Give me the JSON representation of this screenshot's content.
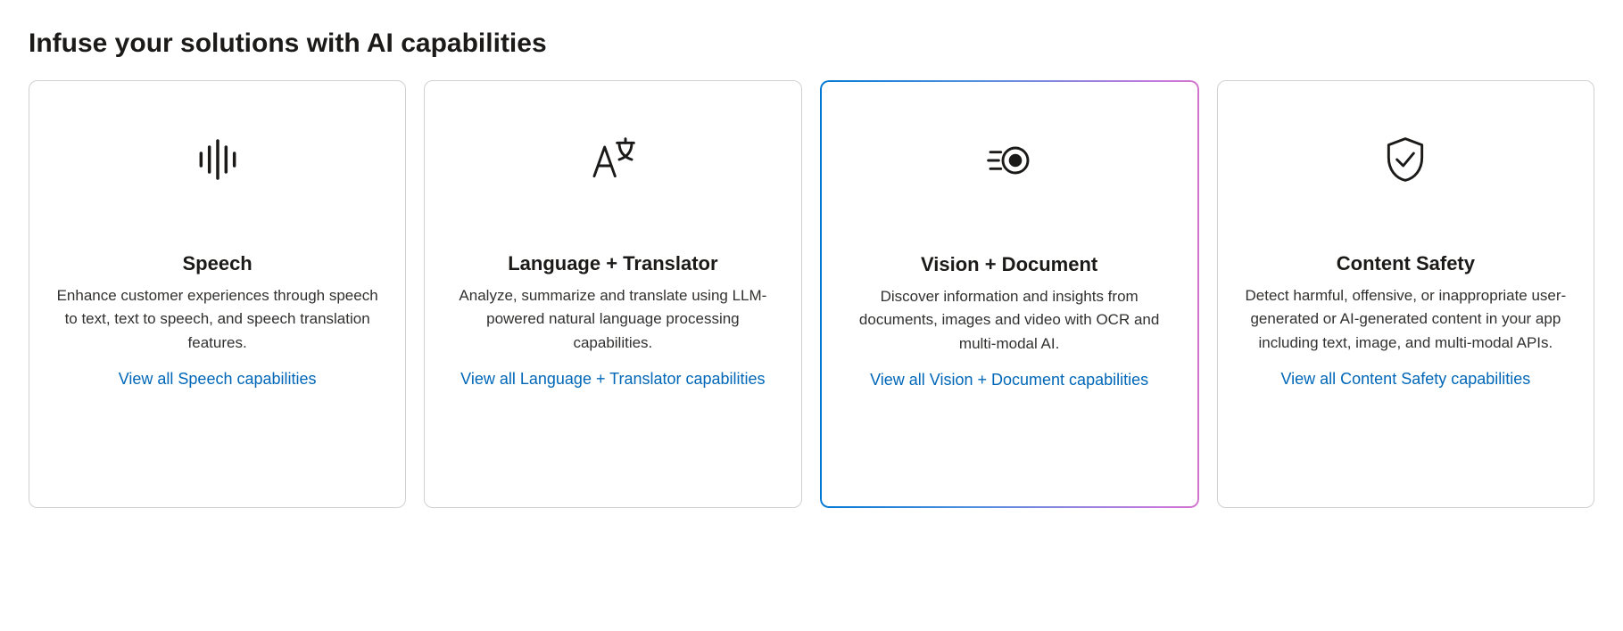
{
  "section": {
    "heading": "Infuse your solutions with AI capabilities"
  },
  "cards": [
    {
      "icon": "audio-wave-icon",
      "title": "Speech",
      "description": "Enhance customer experiences through speech to text, text to speech, and speech translation features.",
      "link_label": "View all Speech capabilities",
      "highlighted": false
    },
    {
      "icon": "translate-icon",
      "title": "Language + Translator",
      "description": "Analyze, summarize and translate using LLM-powered natural language processing capabilities.",
      "link_label": "View all Language + Translator capabilities",
      "highlighted": false
    },
    {
      "icon": "vision-eye-icon",
      "title": "Vision + Document",
      "description": "Discover information and insights from documents, images and video with OCR and multi-modal AI.",
      "link_label": "View all Vision + Document capabilities",
      "highlighted": true
    },
    {
      "icon": "shield-check-icon",
      "title": "Content Safety",
      "description": "Detect harmful, offensive, or inappropriate user-generated or AI-generated content in your app including text, image, and multi-modal APIs.",
      "link_label": "View all Content Safety capabilities",
      "highlighted": false
    }
  ]
}
